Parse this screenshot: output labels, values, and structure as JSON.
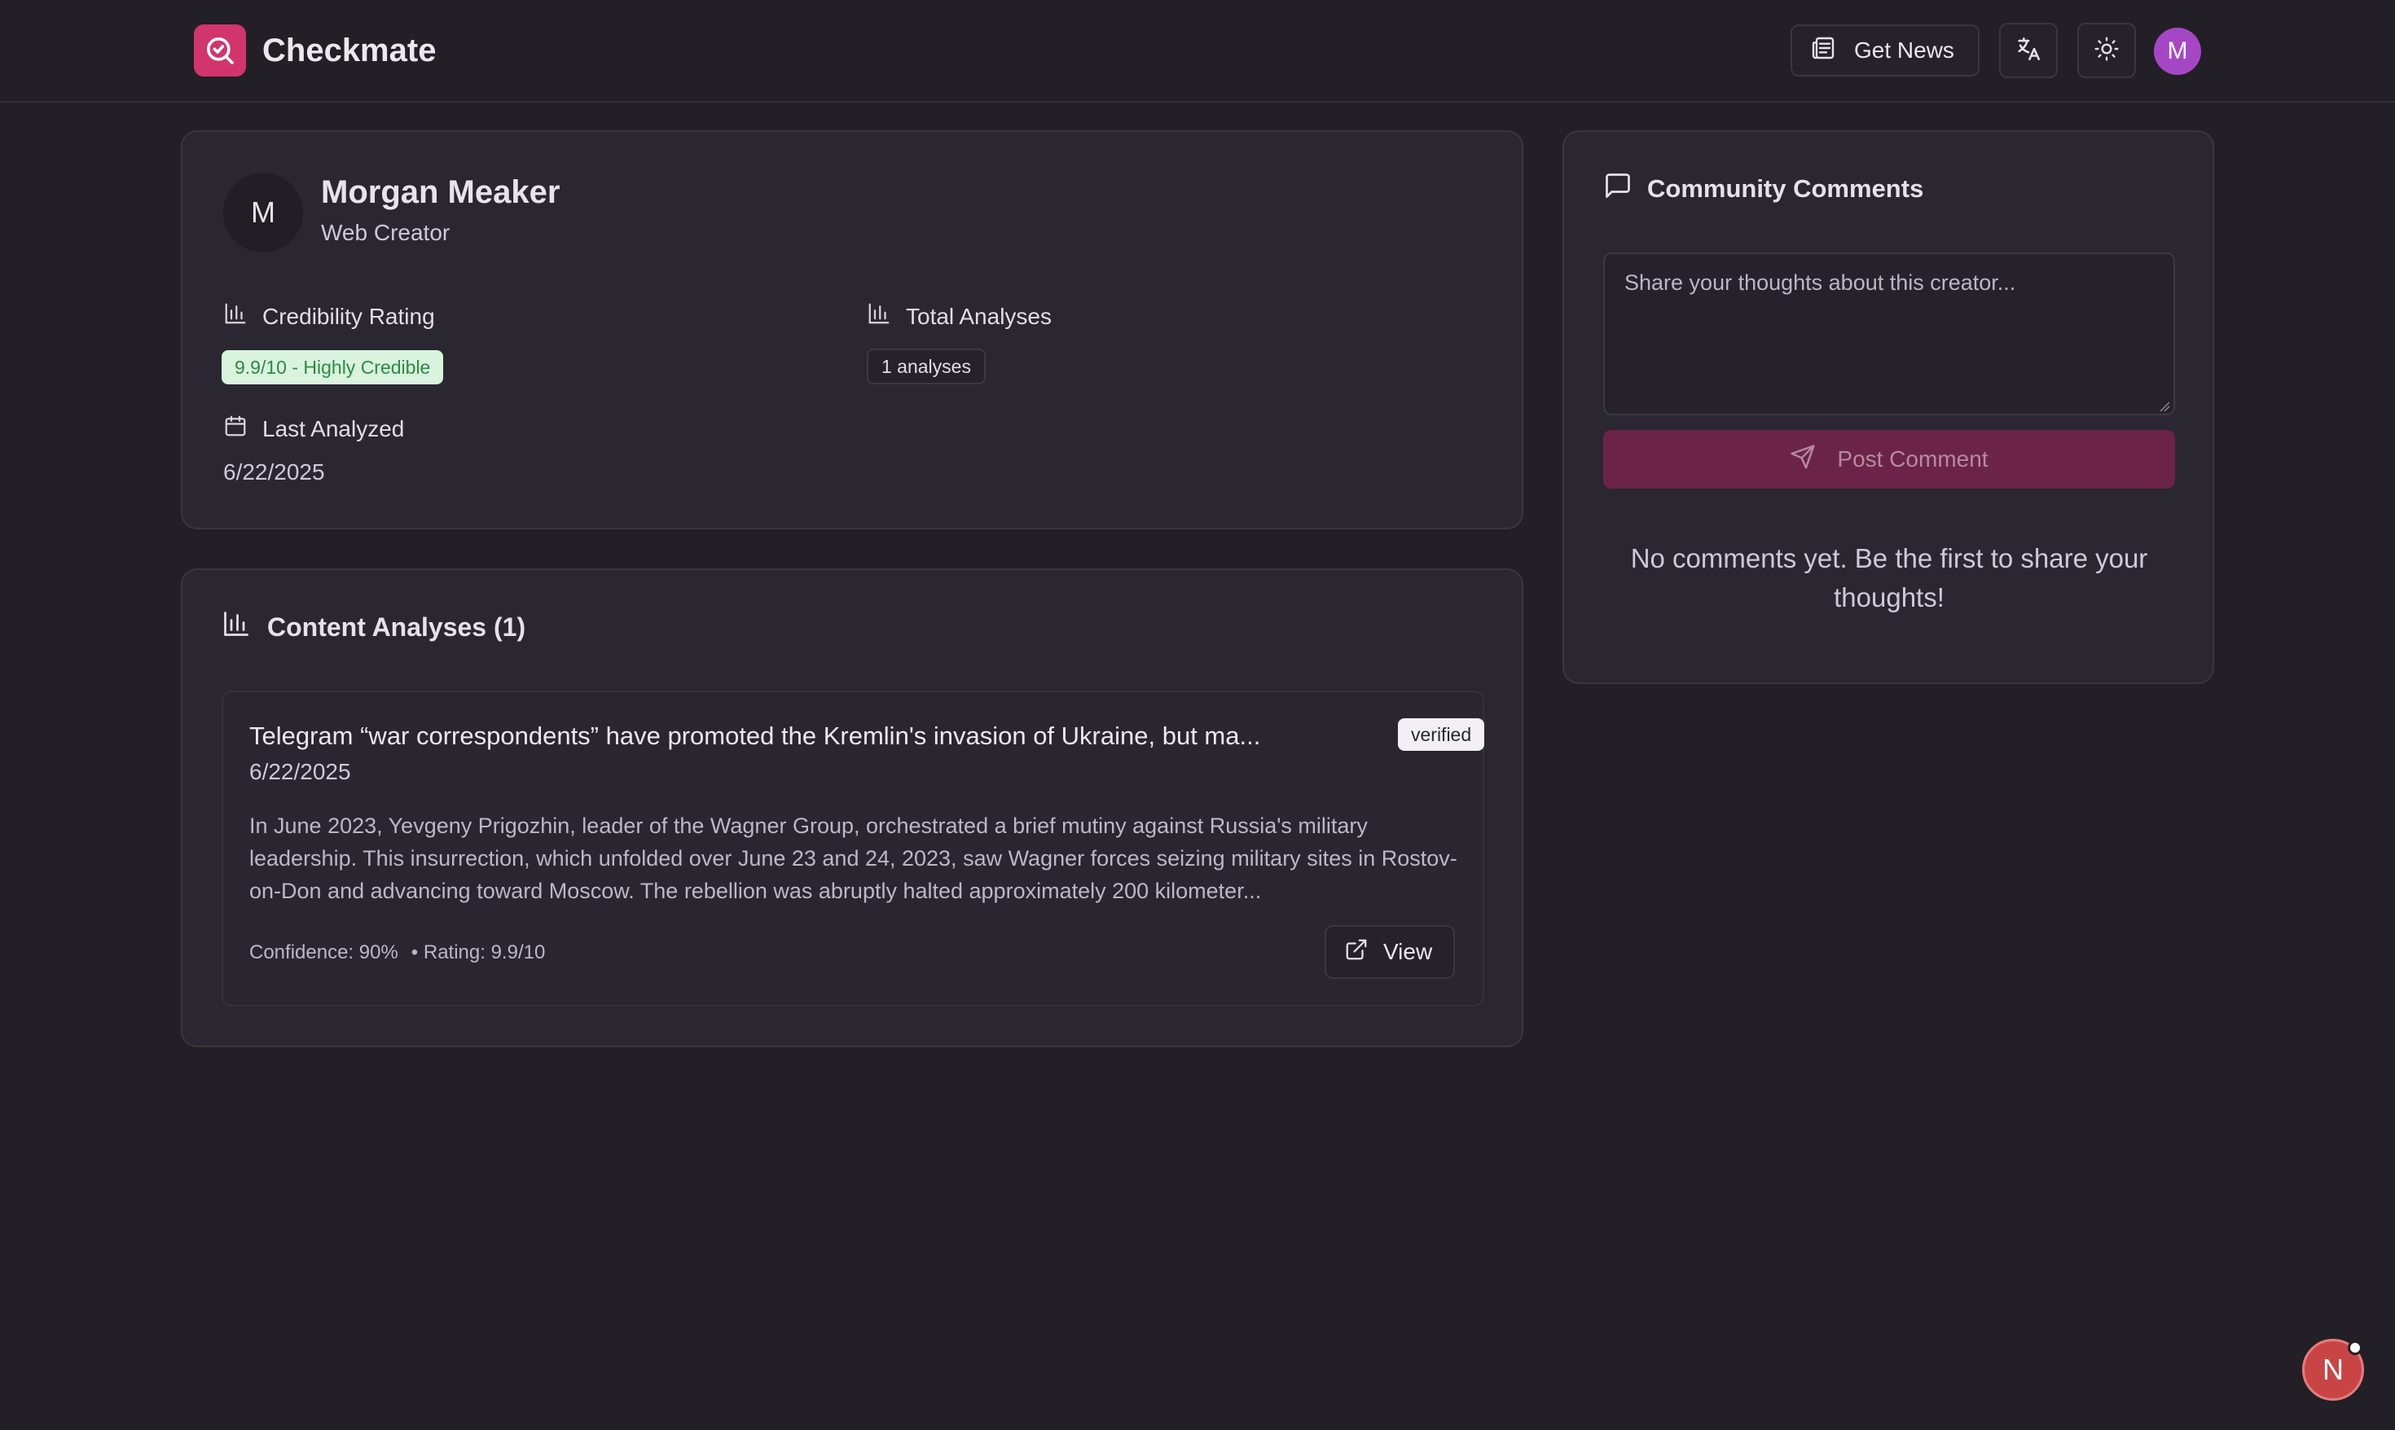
{
  "header": {
    "app_name": "Checkmate",
    "get_news_label": "Get News",
    "user_initial": "M"
  },
  "creator": {
    "initial": "M",
    "name": "Morgan Meaker",
    "role": "Web Creator",
    "credibility_label": "Credibility Rating",
    "credibility_value": "9.9/10 - Highly Credible",
    "total_label": "Total Analyses",
    "total_value": "1 analyses",
    "last_label": "Last Analyzed",
    "last_value": "6/22/2025"
  },
  "analyses": {
    "title": "Content Analyses (1)",
    "items": [
      {
        "title": "Telegram “war correspondents” have promoted the Kremlin's invasion of Ukraine, but ma...",
        "status": "verified",
        "date": "6/22/2025",
        "summary": "In June 2023, Yevgeny Prigozhin, leader of the Wagner Group, orchestrated a brief mutiny against Russia's military leadership. This insurrection, which unfolded over June 23 and 24, 2023, saw Wagner forces seizing military sites in Rostov-on-Don and advancing toward Moscow. The rebellion was abruptly halted approximately 200 kilometer...",
        "confidence": "Confidence: 90%",
        "rating": "• Rating: 9.9/10",
        "view_label": "View"
      }
    ]
  },
  "comments": {
    "title": "Community Comments",
    "placeholder": "Share your thoughts about this creator...",
    "post_label": "Post Comment",
    "empty_text": "No comments yet. Be the first to share your thoughts!"
  },
  "fab": {
    "initial": "N"
  },
  "colors": {
    "background": "#221f27",
    "card": "#2b2731",
    "accent": "#d1356c",
    "post_button": "#6b2447",
    "avatar": "#a547c4",
    "credible_badge_bg": "#d9f3de",
    "credible_badge_text": "#2d8a45"
  },
  "icons": {
    "logo": "search-check-icon",
    "news": "newspaper-icon",
    "translate": "translate-icon",
    "theme": "sun-icon",
    "stat": "bar-chart-icon",
    "calendar": "calendar-icon",
    "comment": "message-square-icon",
    "send": "send-icon",
    "external": "external-link-icon"
  }
}
